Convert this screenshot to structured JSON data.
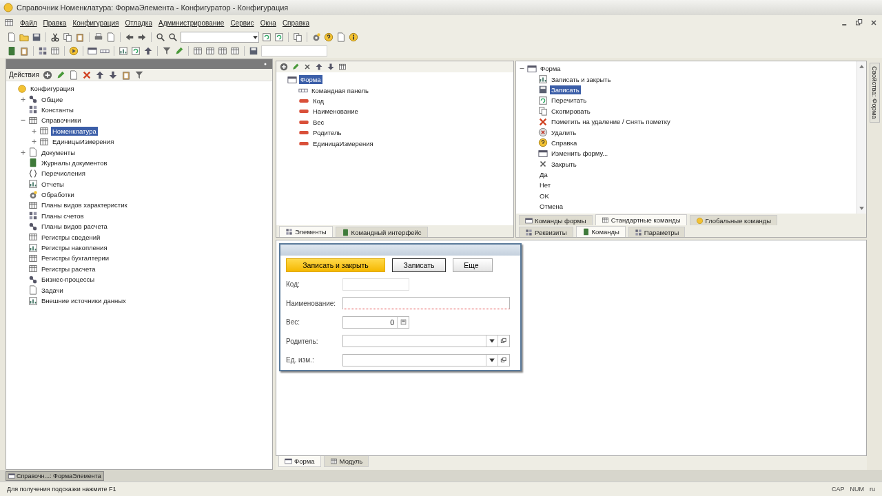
{
  "window": {
    "title": "Справочник Номенклатура: ФормаЭлемента - Конфигуратор - Конфигурация"
  },
  "menu": [
    "Файл",
    "Правка",
    "Конфигурация",
    "Отладка",
    "Администрирование",
    "Сервис",
    "Окна",
    "Справка"
  ],
  "config_panel": {
    "actions_label": "Действия",
    "tree": [
      {
        "label": "Конфигурация",
        "selected": false,
        "children": [
          {
            "label": "Общие",
            "expanded": false,
            "selected": false
          },
          {
            "label": "Константы",
            "selected": false
          },
          {
            "label": "Справочники",
            "expanded": true,
            "selected": false,
            "children": [
              {
                "label": "Номенклатура",
                "expanded": false,
                "selected": true
              },
              {
                "label": "ЕдиницыИзмерения",
                "expanded": false,
                "selected": false
              }
            ]
          },
          {
            "label": "Документы",
            "expanded": false,
            "selected": false
          },
          {
            "label": "Журналы документов",
            "selected": false
          },
          {
            "label": "Перечисления",
            "selected": false
          },
          {
            "label": "Отчеты",
            "selected": false
          },
          {
            "label": "Обработки",
            "selected": false
          },
          {
            "label": "Планы видов характеристик",
            "selected": false
          },
          {
            "label": "Планы счетов",
            "selected": false
          },
          {
            "label": "Планы видов расчета",
            "selected": false
          },
          {
            "label": "Регистры сведений",
            "selected": false
          },
          {
            "label": "Регистры накопления",
            "selected": false
          },
          {
            "label": "Регистры бухгалтерии",
            "selected": false
          },
          {
            "label": "Регистры расчета",
            "selected": false
          },
          {
            "label": "Бизнес-процессы",
            "selected": false
          },
          {
            "label": "Задачи",
            "selected": false
          },
          {
            "label": "Внешние источники данных",
            "selected": false
          }
        ]
      }
    ]
  },
  "elements_panel": {
    "tree": [
      {
        "label": "Форма",
        "selected": true,
        "children": [
          {
            "label": "Командная панель",
            "selected": false
          },
          {
            "label": "Код",
            "selected": false
          },
          {
            "label": "Наименование",
            "selected": false
          },
          {
            "label": "Вес",
            "selected": false
          },
          {
            "label": "Родитель",
            "selected": false
          },
          {
            "label": "ЕдиницаИзмерения",
            "selected": false
          }
        ]
      }
    ],
    "tabs": [
      {
        "label": "Элементы",
        "selected": true
      },
      {
        "label": "Командный интерфейс",
        "selected": false
      }
    ]
  },
  "commands_panel": {
    "tree": [
      {
        "label": "Форма",
        "expanded": true,
        "selected": false,
        "children": [
          {
            "label": "Записать и закрыть",
            "kind": "icon",
            "selected": false
          },
          {
            "label": "Записать",
            "kind": "icon",
            "selected": true
          },
          {
            "label": "Перечитать",
            "kind": "icon",
            "selected": false
          },
          {
            "label": "Скопировать",
            "kind": "icon",
            "selected": false
          },
          {
            "label": "Пометить на удаление / Снять пометку",
            "kind": "icon",
            "selected": false
          },
          {
            "label": "Удалить",
            "kind": "icon",
            "selected": false
          },
          {
            "label": "Справка",
            "kind": "icon",
            "selected": false
          },
          {
            "label": "Изменить форму...",
            "kind": "icon",
            "selected": false
          },
          {
            "label": "Закрыть",
            "kind": "icon",
            "selected": false
          },
          {
            "label": "Да",
            "kind": "plain",
            "selected": false
          },
          {
            "label": "Нет",
            "kind": "plain",
            "selected": false
          },
          {
            "label": "OK",
            "kind": "plain",
            "selected": false
          },
          {
            "label": "Отмена",
            "kind": "plain",
            "selected": false
          }
        ]
      }
    ],
    "command_tabs": [
      {
        "label": "Команды формы",
        "selected": false
      },
      {
        "label": "Стандартные команды",
        "selected": true
      },
      {
        "label": "Глобальные команды",
        "selected": false
      }
    ],
    "tabs": [
      {
        "label": "Реквизиты",
        "selected": false
      },
      {
        "label": "Команды",
        "selected": true
      },
      {
        "label": "Параметры",
        "selected": false
      }
    ]
  },
  "preview_form": {
    "buttons": [
      {
        "label": "Записать и закрыть",
        "kind": "default"
      },
      {
        "label": "Записать",
        "kind": "normal"
      },
      {
        "label": "Еще",
        "kind": "menu"
      }
    ],
    "fields": [
      {
        "label": "Код:",
        "kind": "short"
      },
      {
        "label": "Наименование:",
        "kind": "text",
        "required": true
      },
      {
        "label": "Вес:",
        "kind": "number",
        "value": "0"
      },
      {
        "label": "Родитель:",
        "kind": "choice"
      },
      {
        "label": "Ед. изм.:",
        "kind": "choice"
      }
    ]
  },
  "editor_tabs": [
    {
      "label": "Форма",
      "selected": true
    },
    {
      "label": "Модуль",
      "selected": false
    }
  ],
  "side_tab": {
    "label": "Свойства: Форма"
  },
  "taskbar": [
    {
      "label": "Справочн...: ФормаЭлемента",
      "selected": true
    }
  ],
  "status_bar": {
    "hint": "Для получения подсказки нажмите F1",
    "indicators": [
      "CAP",
      "NUM"
    ],
    "language": "ru"
  }
}
